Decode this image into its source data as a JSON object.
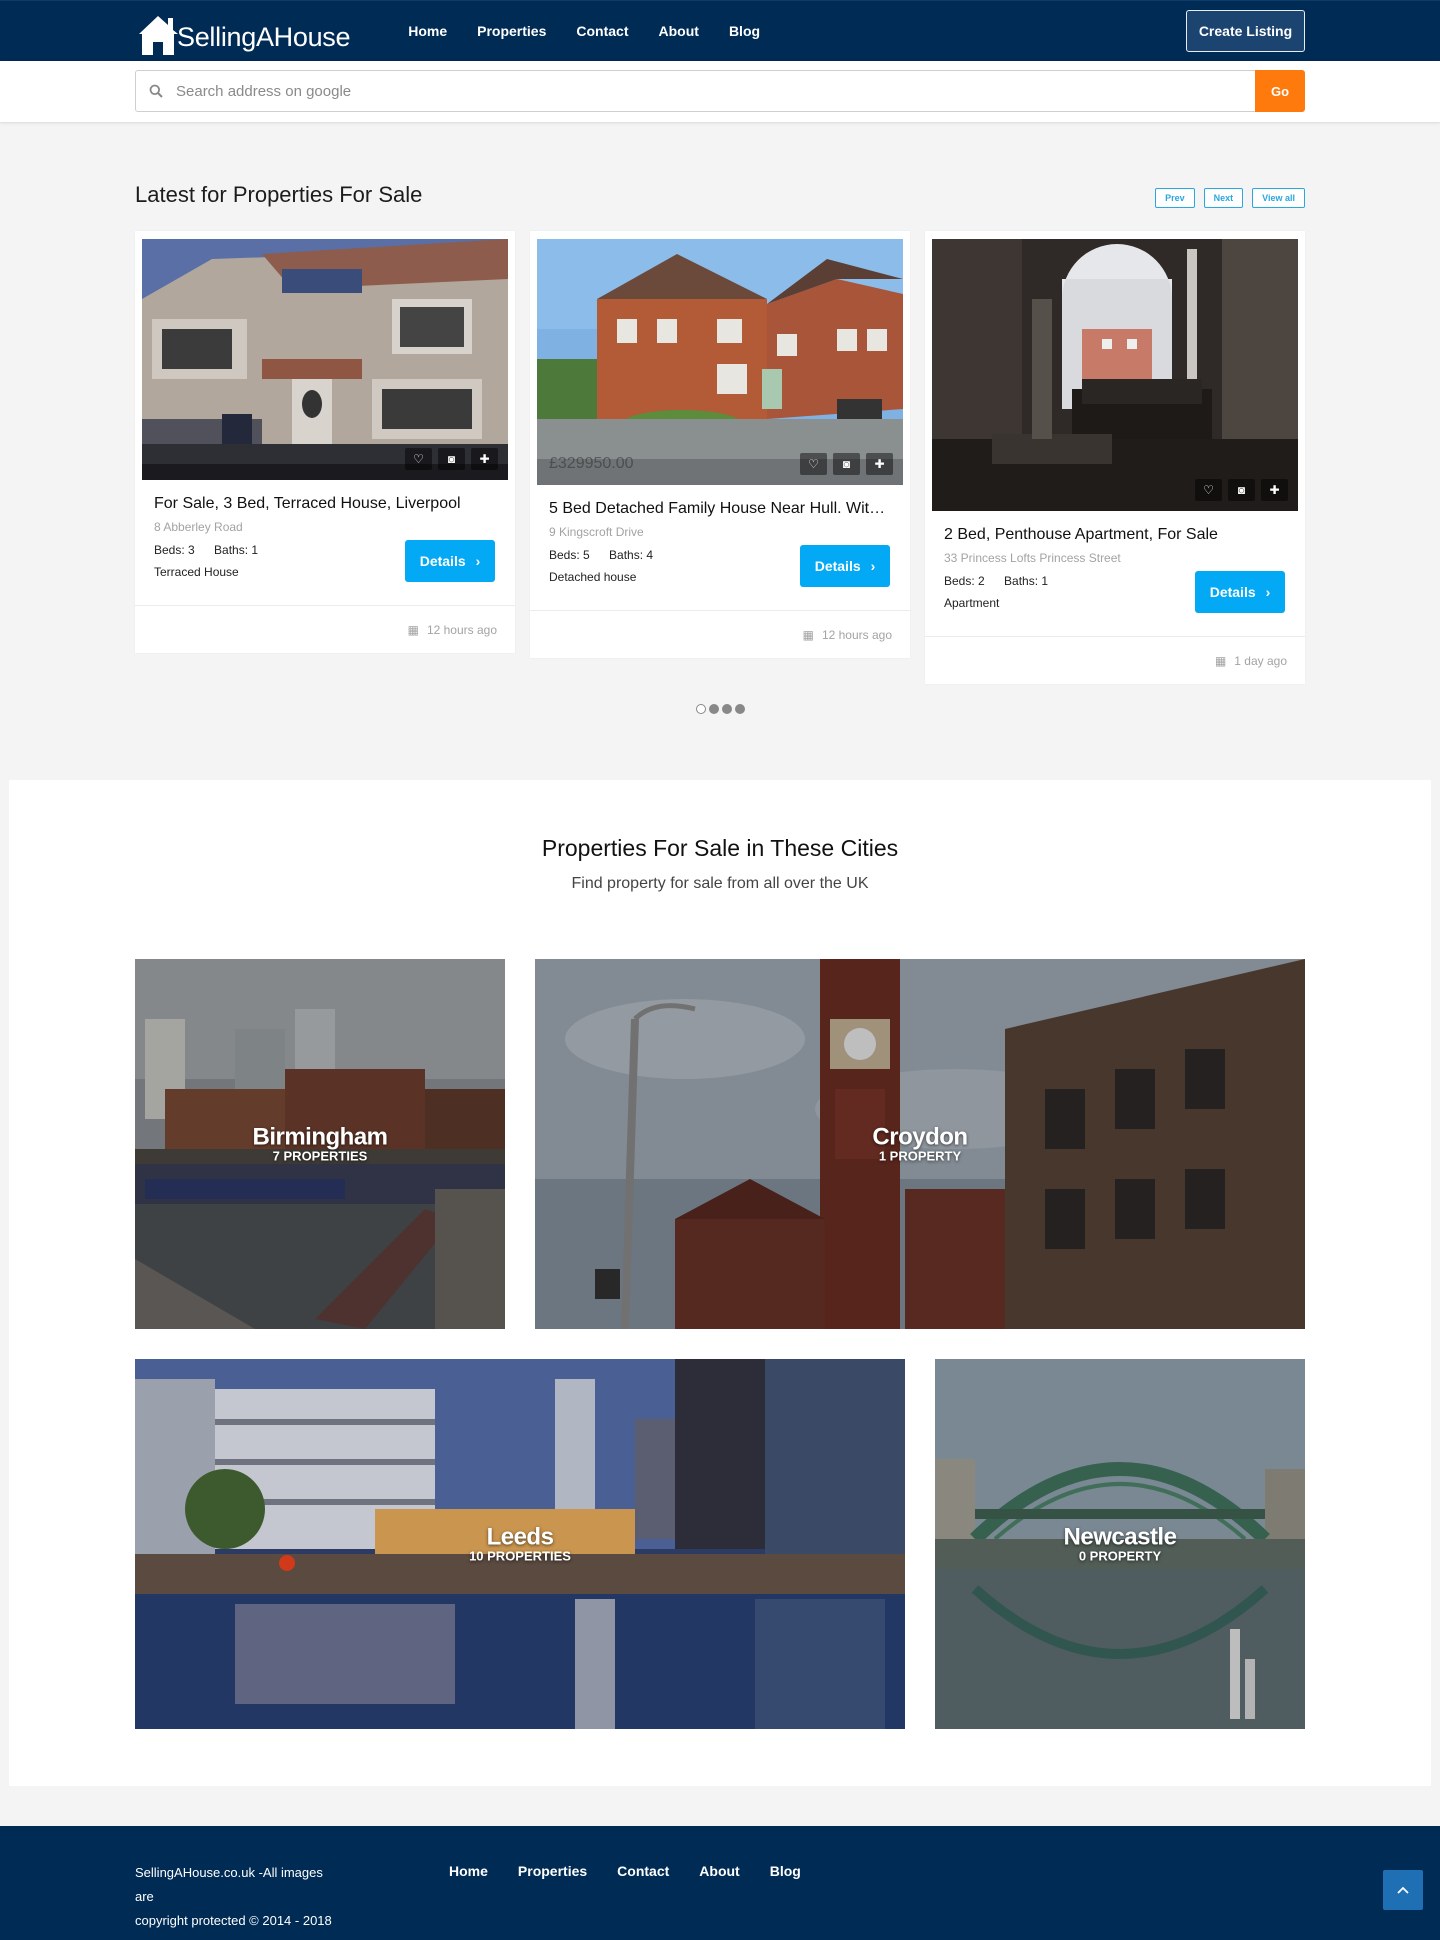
{
  "brand": {
    "name": "SellingAHouse"
  },
  "nav": {
    "items": [
      "Home",
      "Properties",
      "Contact",
      "About",
      "Blog"
    ],
    "create_label": "Create Listing"
  },
  "search": {
    "placeholder": "Search address on google",
    "go_label": "Go"
  },
  "latest": {
    "title": "Latest for Properties For Sale",
    "prev": "Prev",
    "next": "Next",
    "view_all": "View all",
    "cards": [
      {
        "title": "For Sale, 3 Bed, Terraced House, Liverpool",
        "address": "8 Abberley Road",
        "beds": "Beds: 3",
        "baths": "Baths: 1",
        "type": "Terraced House",
        "details": "Details",
        "time": "12 hours ago",
        "price": ""
      },
      {
        "title": "5 Bed Detached Family House Near Hull. With …",
        "address": "9 Kingscroft Drive",
        "beds": "Beds: 5",
        "baths": "Baths: 4",
        "type": "Detached house",
        "details": "Details",
        "time": "12 hours ago",
        "price": "£329950.00"
      },
      {
        "title": "2 Bed, Penthouse Apartment, For Sale",
        "address": "33 Princess Lofts Princess Street",
        "beds": "Beds: 2",
        "baths": "Baths: 1",
        "type": "Apartment",
        "details": "Details",
        "time": "1 day ago",
        "price": ""
      }
    ],
    "carousel": {
      "count": 4,
      "active": 0
    }
  },
  "cities": {
    "title": "Properties For Sale in These Cities",
    "subtitle": "Find property for sale from all over the UK",
    "items": [
      {
        "name": "Birmingham",
        "count": "7 PROPERTIES"
      },
      {
        "name": "Croydon",
        "count": "1 PROPERTY"
      },
      {
        "name": "Leeds",
        "count": "10 PROPERTIES"
      },
      {
        "name": "Newcastle",
        "count": "0 PROPERTY"
      }
    ]
  },
  "footer": {
    "copy_line1": "SellingAHouse.co.uk -All images are",
    "copy_line2": "copyright protected © 2014 - 2018",
    "links": [
      "Home",
      "Properties",
      "Contact",
      "About",
      "Blog"
    ]
  },
  "colors": {
    "navy": "#002b55",
    "accent_blue": "#03a9f4",
    "orange": "#ff7a0c"
  },
  "icons": [
    "house-logo-icon",
    "search-icon",
    "heart-icon",
    "camera-icon",
    "plus-icon",
    "chevron-right-icon",
    "calendar-icon",
    "chevron-up-icon"
  ]
}
